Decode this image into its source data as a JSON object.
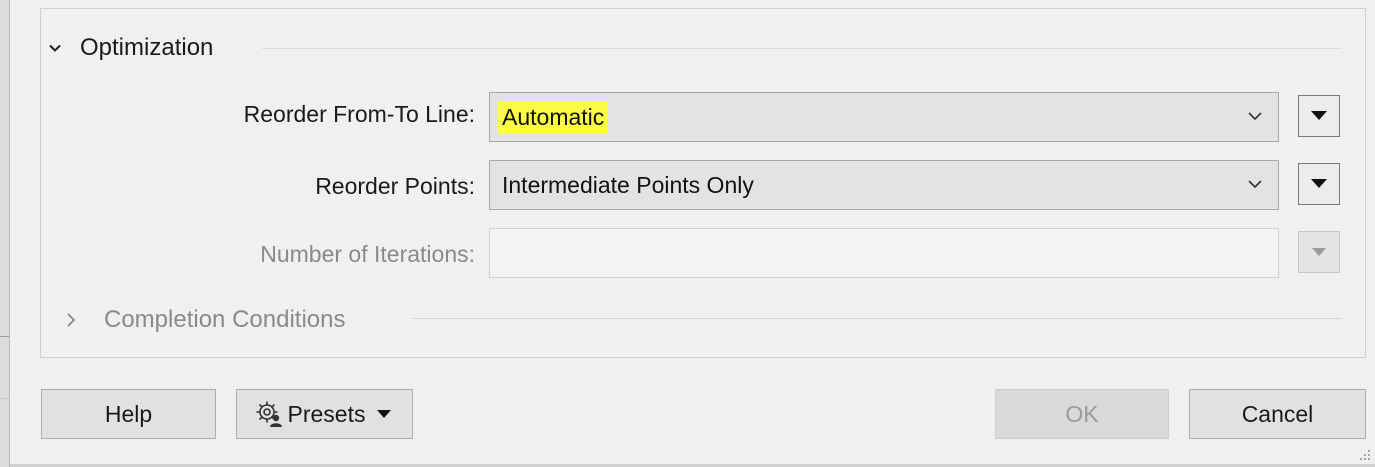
{
  "section": {
    "title": "Optimization",
    "expand_icon": "chevron-down-icon"
  },
  "fields": {
    "reorder_from_to": {
      "label": "Reorder From-To Line:",
      "value": "Automatic",
      "highlight_color": "#fcfc45"
    },
    "reorder_points": {
      "label": "Reorder Points:",
      "value": "Intermediate Points Only"
    },
    "iterations": {
      "label": "Number of Iterations:",
      "value": "",
      "disabled": true
    }
  },
  "subsection": {
    "title": "Completion Conditions",
    "expand_icon": "chevron-right-icon",
    "collapsed": true
  },
  "buttons": {
    "help": "Help",
    "presets": "Presets",
    "presets_icon": "gear-person-icon",
    "ok": "OK",
    "ok_disabled": true,
    "cancel": "Cancel"
  }
}
